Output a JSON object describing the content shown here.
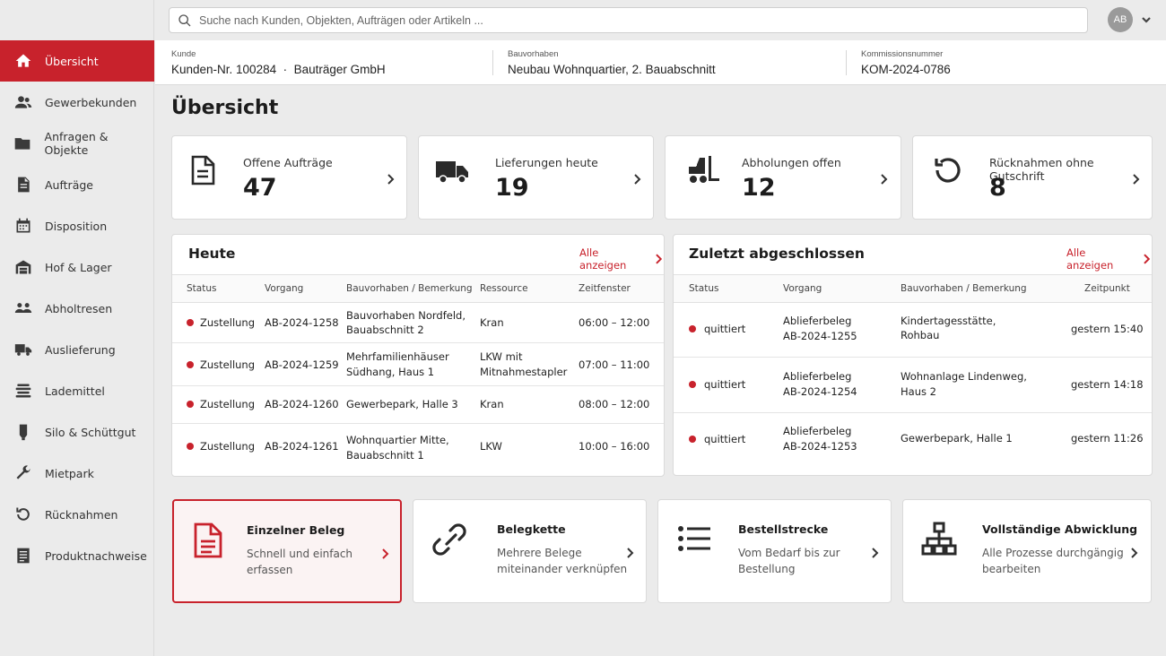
{
  "search": {
    "placeholder": "Suche nach Kunden, Objekten, Aufträgen oder Artikeln ..."
  },
  "user": {
    "initials": "AB"
  },
  "sidebar": {
    "items": [
      {
        "label": "Übersicht",
        "icon": "home-icon",
        "active": true
      },
      {
        "label": "Gewerbekunden",
        "icon": "users-icon"
      },
      {
        "label": "Anfragen & Objekte",
        "icon": "folder-icon"
      },
      {
        "label": "Aufträge",
        "icon": "document-icon"
      },
      {
        "label": "Disposition",
        "icon": "calendar-icon"
      },
      {
        "label": "Hof & Lager",
        "icon": "warehouse-icon"
      },
      {
        "label": "Abholtresen",
        "icon": "counter-icon"
      },
      {
        "label": "Auslieferung",
        "icon": "truck-icon"
      },
      {
        "label": "Lademittel",
        "icon": "pallet-icon"
      },
      {
        "label": "Silo & Schüttgut",
        "icon": "silo-icon"
      },
      {
        "label": "Mietpark",
        "icon": "wrench-icon"
      },
      {
        "label": "Rücknahmen",
        "icon": "return-icon"
      },
      {
        "label": "Produktnachweise",
        "icon": "certificate-icon"
      }
    ]
  },
  "context": {
    "customer_label": "Kunde",
    "customer_value": "Kunden-Nr. 100284  ·  Bauträger GmbH",
    "project_label": "Bauvorhaben",
    "project_value": "Neubau Wohnquartier, 2. Bauabschnitt",
    "commission_label": "Kommissionsnummer",
    "commission_value": "KOM-2024-0786"
  },
  "page_title": "Übersicht",
  "kpis": [
    {
      "label": "Offene Aufträge",
      "value": "47",
      "icon": "document-icon"
    },
    {
      "label": "Lieferungen heute",
      "value": "19",
      "icon": "truck-icon"
    },
    {
      "label": "Abholungen offen",
      "value": "12",
      "icon": "forklift-icon"
    },
    {
      "label": "Rücknahmen ohne Gutschrift",
      "value": "8",
      "icon": "return-icon"
    }
  ],
  "today": {
    "title": "Heute",
    "link": "Alle anzeigen",
    "columns": [
      "Status",
      "Vorgang",
      "Bauvorhaben / Bemerkung",
      "Ressource",
      "Zeitfenster"
    ],
    "rows": [
      {
        "status": "Zustellung",
        "id": "AB-2024-1258",
        "project": [
          "Bauvorhaben Nordfeld,",
          "Bauabschnitt 2"
        ],
        "resource": [
          "Kran"
        ],
        "window": "06:00 – 12:00"
      },
      {
        "status": "Zustellung",
        "id": "AB-2024-1259",
        "project": [
          "Mehrfamilienhäuser",
          "Südhang, Haus 1"
        ],
        "resource": [
          "LKW mit",
          "Mitnahmestapler"
        ],
        "window": "07:00 – 11:00"
      },
      {
        "status": "Zustellung",
        "id": "AB-2024-1260",
        "project": [
          "Gewerbepark, Halle 3"
        ],
        "resource": [
          "Kran"
        ],
        "window": "08:00 – 12:00"
      },
      {
        "status": "Zustellung",
        "id": "AB-2024-1261",
        "project": [
          "Wohnquartier Mitte,",
          "Bauabschnitt 1"
        ],
        "resource": [
          "LKW"
        ],
        "window": "10:00 – 16:00"
      }
    ]
  },
  "recent": {
    "title": "Zuletzt abgeschlossen",
    "link": "Alle anzeigen",
    "columns": [
      "Status",
      "Vorgang",
      "Bauvorhaben / Bemerkung",
      "Zeitpunkt"
    ],
    "rows": [
      {
        "status": "quittiert",
        "doc": [
          "Ablieferbeleg",
          "AB-2024-1255"
        ],
        "project": [
          "Kindertagesstätte,",
          "Rohbau"
        ],
        "time": "gestern 15:40"
      },
      {
        "status": "quittiert",
        "doc": [
          "Ablieferbeleg",
          "AB-2024-1254"
        ],
        "project": [
          "Wohnanlage Lindenweg,",
          "Haus 2"
        ],
        "time": "gestern 14:18"
      },
      {
        "status": "quittiert",
        "doc": [
          "Ablieferbeleg",
          "AB-2024-1253"
        ],
        "project": [
          "Gewerbepark, Halle 1"
        ],
        "time": "gestern 11:26"
      }
    ]
  },
  "actions": [
    {
      "title": "Einzelner Beleg",
      "desc": [
        "Schnell und einfach",
        "erfassen"
      ],
      "icon": "document-icon",
      "active": true
    },
    {
      "title": "Belegkette",
      "desc": [
        "Mehrere Belege",
        "miteinander verknüpfen"
      ],
      "icon": "link-icon"
    },
    {
      "title": "Bestellstrecke",
      "desc": [
        "Vom Bedarf bis zur",
        "Bestellung"
      ],
      "icon": "list-icon"
    },
    {
      "title": "Vollständige Abwicklung",
      "desc": [
        "Alle Prozesse durchgängig",
        "bearbeiten"
      ],
      "icon": "hierarchy-icon"
    }
  ],
  "colors": {
    "accent": "#c8222c",
    "background": "#ebebeb",
    "card": "#ffffff"
  }
}
